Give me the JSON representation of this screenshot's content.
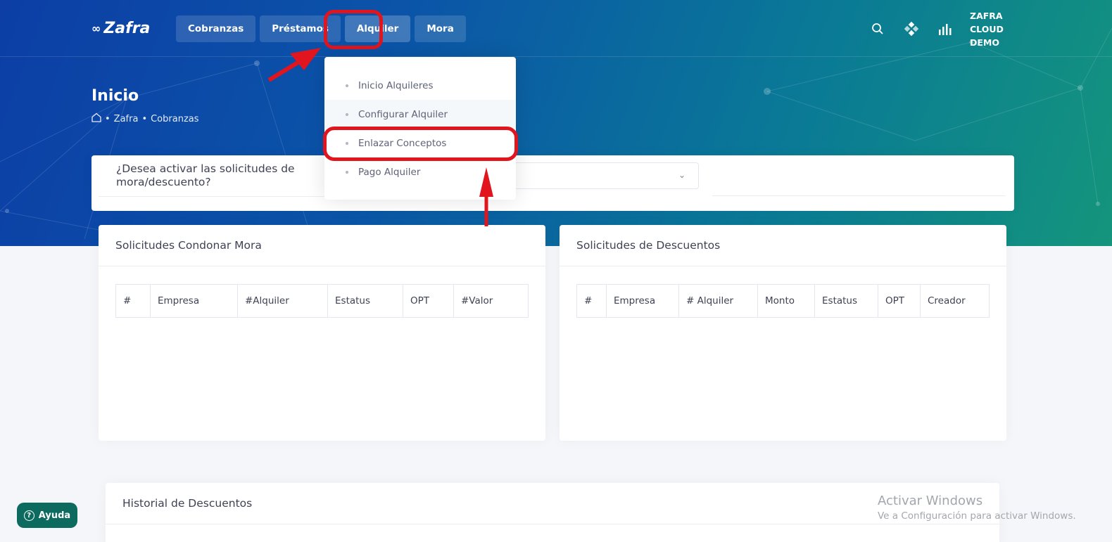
{
  "brand": {
    "name": "Zafra"
  },
  "nav": {
    "items": [
      {
        "label": "Cobranzas"
      },
      {
        "label": "Préstamos"
      },
      {
        "label": "Alquiler"
      },
      {
        "label": "Mora"
      }
    ]
  },
  "user": {
    "line1": "ZAFRA",
    "line2": "CLOUD",
    "line3": "DEMO"
  },
  "toolbar_icons": [
    "search-icon",
    "apps-icon",
    "chart-icon"
  ],
  "page": {
    "title": "Inicio",
    "breadcrumb": [
      "Zafra",
      "Cobranzas"
    ]
  },
  "question": {
    "text": "¿Desea activar las solicitudes de mora/descuento?"
  },
  "dropdown": {
    "items": [
      {
        "label": "Inicio Alquileres"
      },
      {
        "label": "Configurar Alquiler"
      },
      {
        "label": "Enlazar Conceptos"
      },
      {
        "label": "Pago Alquiler"
      }
    ]
  },
  "mora_card": {
    "title": "Solicitudes Condonar Mora",
    "columns": [
      "#",
      "Empresa",
      "#Alquiler",
      "Estatus",
      "OPT",
      "#Valor"
    ]
  },
  "desc_card": {
    "title": "Solicitudes de Descuentos",
    "columns": [
      "#",
      "Empresa",
      "# Alquiler",
      "Monto",
      "Estatus",
      "OPT",
      "Creador"
    ]
  },
  "history_card": {
    "title": "Historial de Descuentos"
  },
  "help": {
    "label": "Ayuda"
  },
  "watermark": {
    "line1": "Activar Windows",
    "line2": "Ve a Configuración para activar Windows."
  },
  "colors": {
    "annotation_red": "#e0151e",
    "help_bg": "#0c6a5f",
    "hero_start": "#0c3ea6",
    "hero_end": "#14957c"
  }
}
